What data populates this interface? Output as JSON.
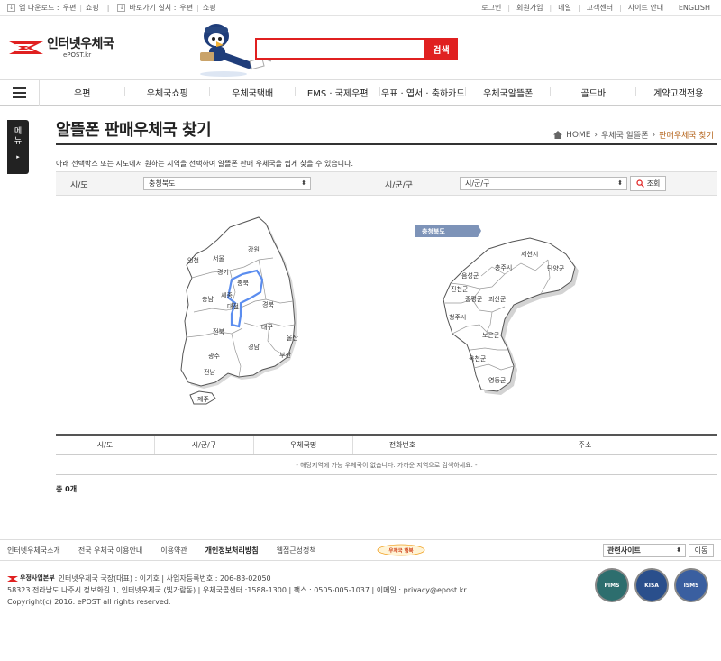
{
  "topbar": {
    "app_download_label": "앱 다운로드 :",
    "app_links": [
      "우편",
      "쇼핑"
    ],
    "shortcut_label": "바로가기 설치 :",
    "shortcut_links": [
      "우편",
      "쇼핑"
    ],
    "right_links": [
      "로그인",
      "회원가입",
      "메일",
      "고객센터",
      "사이트 안내",
      "ENGLISH"
    ]
  },
  "header": {
    "logo_title": "인터넷우체국",
    "logo_sub": "ePOST.kr",
    "search_placeholder": "",
    "search_button": "검색"
  },
  "gnb": {
    "items": [
      "우편",
      "우체국쇼핑",
      "우체국택배",
      "EMS · 국제우편",
      "우표 · 엽서 · 축하카드",
      "우체국알뜰폰",
      "골드바",
      "계약고객전용"
    ]
  },
  "sidetab": {
    "label_1": "메",
    "label_2": "뉴",
    "arrow": "▸"
  },
  "page": {
    "title": "알뜰폰 판매우체국 찾기",
    "breadcrumb": [
      "HOME",
      "우체국 알뜰폰",
      "판매우체국 찾기"
    ],
    "description": "아래 선택박스 또는 지도에서 원하는 지역을 선택하여 알뜰폰 판매 우체국을 쉽게 찾을 수 있습니다."
  },
  "filters": {
    "sido_label": "시/도",
    "sido_value": "충청북도",
    "sigungu_label": "시/군/구",
    "sigungu_value": "시/군/구",
    "search_button": "조회"
  },
  "map_korea": {
    "labels": [
      "강원",
      "인천",
      "서울",
      "경기",
      "충북",
      "충남",
      "세종",
      "대전",
      "경북",
      "대구",
      "전북",
      "울산",
      "경남",
      "부산",
      "광주",
      "전남",
      "제주"
    ]
  },
  "map_region": {
    "title": "충청북도",
    "labels": [
      "제천시",
      "충주시",
      "단양군",
      "음성군",
      "진천군",
      "증평군",
      "괴산군",
      "청주시",
      "보은군",
      "옥천군",
      "영동군"
    ]
  },
  "results": {
    "columns": [
      "시/도",
      "시/군/구",
      "우체국명",
      "전화번호",
      "주소"
    ],
    "empty_message": "- 해당지역에 가능 우체국이 없습니다. 가까운 지역으로 검색하세요. -",
    "total": "총 0개"
  },
  "footer": {
    "links": [
      "인터넷우체국소개",
      "전국 우체국 이용안내",
      "이용약관",
      "개인정보처리방침",
      "웹접근성정책"
    ],
    "badge_text": "우체국 행복",
    "related_select": "관련사이트",
    "go_button": "이동",
    "org_logo": "우정사업본부",
    "info_line1": "인터넷우체국 국장(대표) : 이기호   |   사업자등록번호 : 206-83-02050",
    "info_line2": "58323 전라남도 나주시 정보화길 1, 인터넷우체국 (빛가람동)   |   우체국콜센터 :1588-1300   |   팩스 : 0505-005-1037   |   이메일 : privacy@epost.kr",
    "copyright": "Copyright(c) 2016. ePOST all rights reserved.",
    "certs": [
      "PIMS",
      "KISA",
      "ISMS"
    ]
  },
  "colors": {
    "brand_red": "#e02020",
    "highlight_blue": "#5b8def",
    "region_tag": "#7d93b8"
  }
}
